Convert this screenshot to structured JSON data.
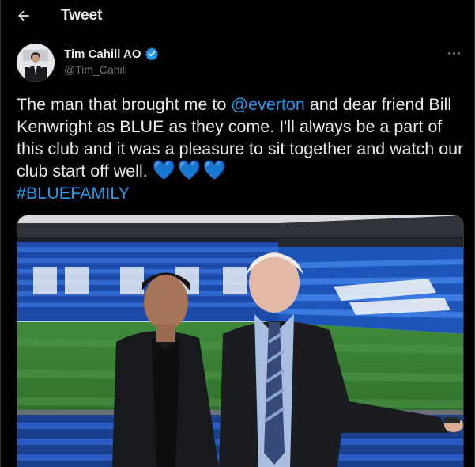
{
  "header": {
    "title": "Tweet",
    "back_icon": "arrow-left-icon"
  },
  "author": {
    "display_name": "Tim Cahill AO",
    "handle": "@Tim_Cahill",
    "verified_icon": "verified-badge-icon",
    "avatar_icon": "avatar"
  },
  "tweet": {
    "text_before_mention": "The man that brought me to ",
    "mention": "@everton",
    "text_after_mention": " and dear friend Bill Kenwright as BLUE as they come. I'll always be a part of this club and it was a pleasure to sit together and watch our club start off well. ",
    "hearts": "💙💙💙",
    "hashtag": "#BLUEFAMILY"
  },
  "colors": {
    "background": "#000000",
    "text": "#e7e9ea",
    "secondary_text": "#71767b",
    "accent": "#1d9bf0",
    "border": "#2f3336"
  }
}
